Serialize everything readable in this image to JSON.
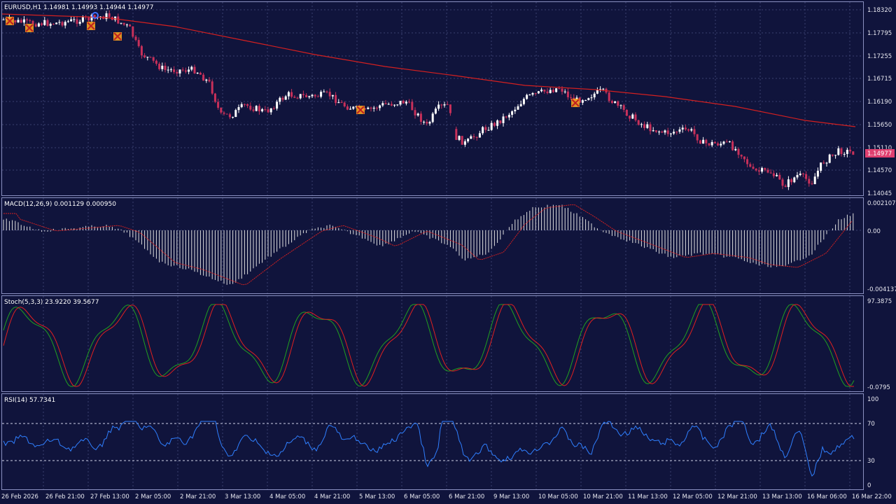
{
  "symbol_label": "EURUSD,H1  1.14981 1.14993 1.14944 1.14977",
  "current_price": "1.14977",
  "price_axis": [
    "1.18320",
    "1.17795",
    "1.17255",
    "1.16715",
    "1.16190",
    "1.15650",
    "1.15110",
    "1.14570",
    "1.14045"
  ],
  "macd": {
    "label": "MACD(12,26,9) 0.001129 0.000950",
    "axis": [
      "0.002107",
      "0.00",
      "-0.004137"
    ]
  },
  "stoch": {
    "label": "Stoch(5,3,3) 23.9220 39.5677",
    "axis_top": "97.3875",
    "axis_bottom": "-0.0795"
  },
  "rsi": {
    "label": "RSI(14) 57.7341",
    "axis": [
      "100",
      "70",
      "30",
      "0"
    ]
  },
  "time_axis": [
    "26 Feb 2026",
    "26 Feb 21:00",
    "27 Feb 13:00",
    "2 Mar 05:00",
    "2 Mar 21:00",
    "3 Mar 13:00",
    "4 Mar 05:00",
    "4 Mar 21:00",
    "5 Mar 13:00",
    "6 Mar 05:00",
    "6 Mar 21:00",
    "9 Mar 13:00",
    "10 Mar 05:00",
    "10 Mar 21:00",
    "11 Mar 13:00",
    "12 Mar 05:00",
    "12 Mar 21:00",
    "13 Mar 13:00",
    "16 Mar 06:00",
    "16 Mar 22:00"
  ],
  "colors": {
    "background": "#10143c",
    "grid": "#3a4070",
    "bull_candle": "#ffffff",
    "bear_candle": "#c8305a",
    "moving_average": "#d42020",
    "macd_hist": "#e0e0e0",
    "macd_signal": "#d42020",
    "stoch_main": "#20a020",
    "stoch_signal": "#e02020",
    "rsi_line": "#2f7fff",
    "level_line": "#ffffff"
  }
}
